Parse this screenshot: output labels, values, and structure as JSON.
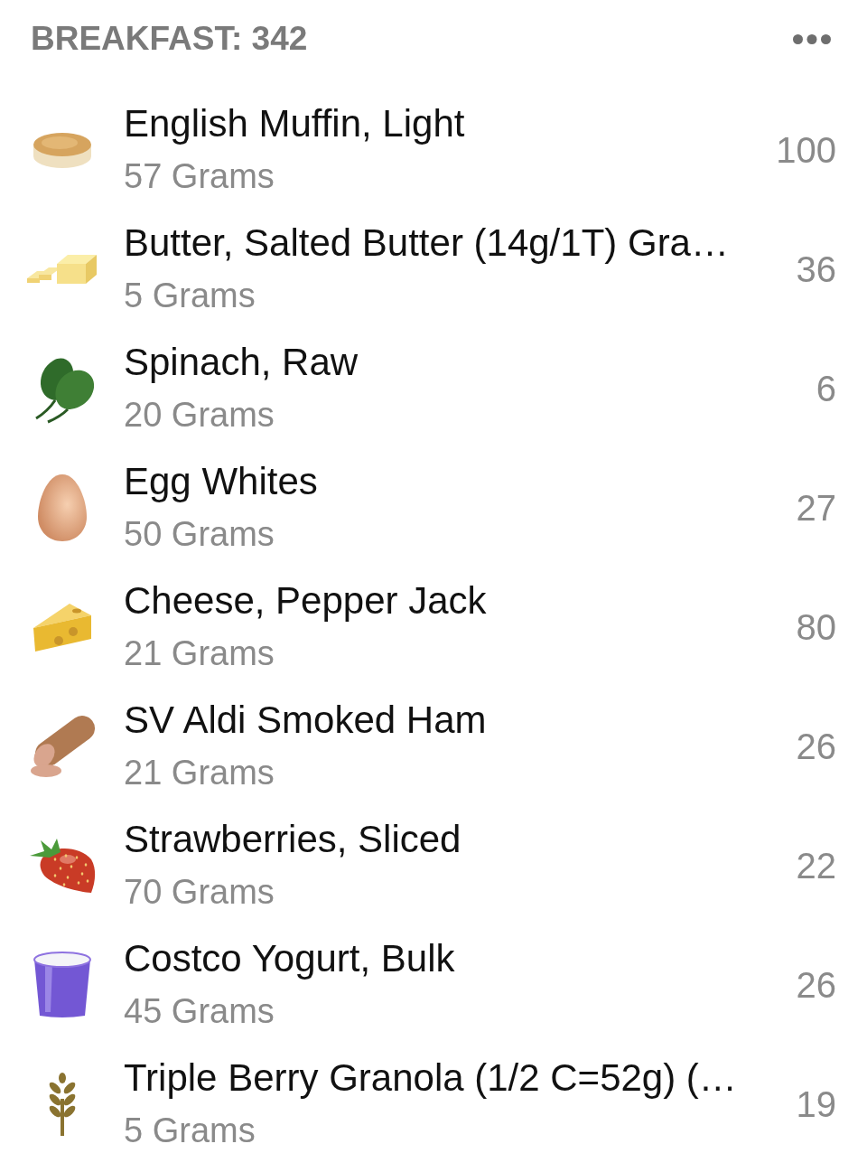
{
  "meal": {
    "title": "BREAKFAST: 342"
  },
  "items": [
    {
      "kind": "muffin",
      "name": "English Muffin, Light",
      "serving": "57 Grams",
      "calories": "100"
    },
    {
      "kind": "butter",
      "name": "Butter, Salted Butter (14g/1T) Gra…",
      "serving": "5 Grams",
      "calories": "36"
    },
    {
      "kind": "spinach",
      "name": "Spinach, Raw",
      "serving": "20 Grams",
      "calories": "6"
    },
    {
      "kind": "egg",
      "name": "Egg Whites",
      "serving": "50 Grams",
      "calories": "27"
    },
    {
      "kind": "cheese",
      "name": "Cheese, Pepper Jack",
      "serving": "21 Grams",
      "calories": "80"
    },
    {
      "kind": "ham",
      "name": "SV Aldi Smoked Ham",
      "serving": "21 Grams",
      "calories": "26"
    },
    {
      "kind": "strawberry",
      "name": "Strawberries, Sliced",
      "serving": "70 Grams",
      "calories": "22"
    },
    {
      "kind": "yogurt",
      "name": "Costco Yogurt, Bulk",
      "serving": "45 Grams",
      "calories": "26"
    },
    {
      "kind": "granola",
      "name": "Triple Berry Granola (1/2 C=52g) (…",
      "serving": "5 Grams",
      "calories": "19"
    }
  ]
}
